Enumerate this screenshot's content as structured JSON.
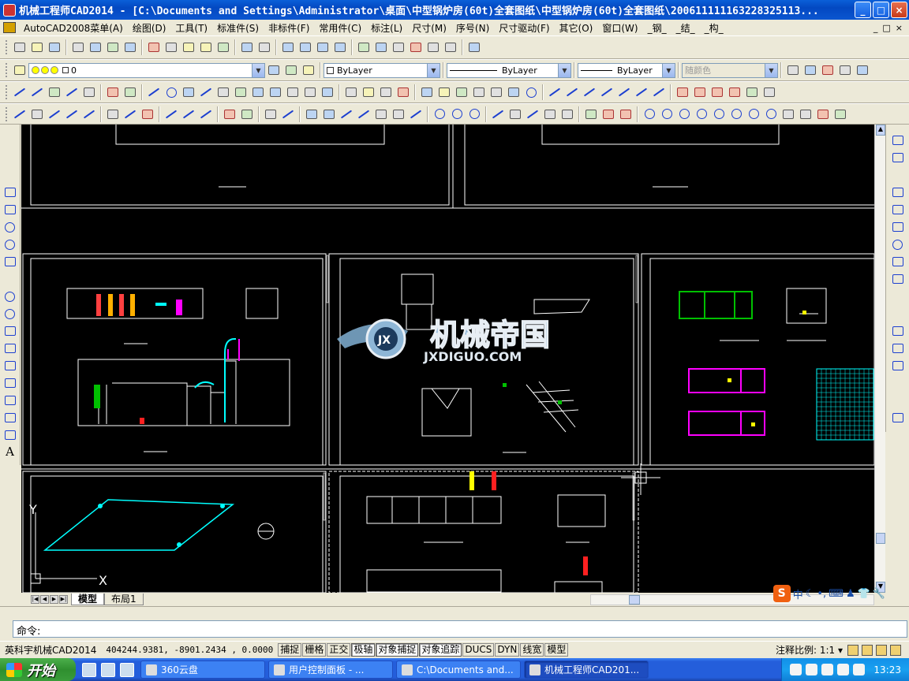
{
  "window": {
    "title": "机械工程师CAD2014 - [C:\\Documents and Settings\\Administrator\\桌面\\中型锅炉房(60t)全套图纸\\中型锅炉房(60t)全套图纸\\200611111163228325113...",
    "minimize": "_",
    "maximize": "□",
    "close": "×"
  },
  "menu": {
    "items": [
      "AutoCAD2008菜单(A)",
      "绘图(D)",
      "工具(T)",
      "标准件(S)",
      "非标件(F)",
      "常用件(C)",
      "标注(L)",
      "尺寸(M)",
      "序号(N)",
      "尺寸驱动(F)",
      "其它(O)",
      "窗口(W)",
      "_钢_",
      "_结_",
      "_构_"
    ],
    "doc_controls": [
      "_",
      "□",
      "×"
    ]
  },
  "layer_toolbar": {
    "layer_name": "0",
    "color": "ByLayer",
    "linetype": "ByLayer",
    "lineweight": "ByLayer",
    "plotstyle": "随颜色"
  },
  "drawing": {
    "watermark_cn": "机械帝国",
    "watermark_en": "JXDIGUO.COM",
    "watermark_badge": "JX",
    "axis_x": "X",
    "axis_y": "Y"
  },
  "tabs": {
    "items": [
      "模型",
      "布局1"
    ],
    "active": 0
  },
  "ime": {
    "logo": "S",
    "mode": "中"
  },
  "command": {
    "prompt": "命令:"
  },
  "status": {
    "app": "英科宇机械CAD2014",
    "coords": "404244.9381, -8901.2434 , 0.0000",
    "toggles": [
      {
        "label": "捕捉",
        "on": false
      },
      {
        "label": "栅格",
        "on": false
      },
      {
        "label": "正交",
        "on": false
      },
      {
        "label": "极轴",
        "on": true
      },
      {
        "label": "对象捕捉",
        "on": true
      },
      {
        "label": "对象追踪",
        "on": true
      },
      {
        "label": "DUCS",
        "on": false
      },
      {
        "label": "DYN",
        "on": false
      },
      {
        "label": "线宽",
        "on": false
      },
      {
        "label": "模型",
        "on": false
      }
    ],
    "annotation_scale": "注释比例: 1:1 ▾"
  },
  "taskbar": {
    "start": "开始",
    "tasks": [
      {
        "label": "360云盘",
        "active": false
      },
      {
        "label": "用户控制面板 - ...",
        "active": false
      },
      {
        "label": "C:\\Documents and...",
        "active": false
      },
      {
        "label": "机械工程师CAD201...",
        "active": true
      }
    ],
    "clock": "13:23"
  },
  "colors": {
    "titlebar": "#0348c1",
    "canvas": "#000000",
    "cad_line": "#ffffff",
    "cad_green": "#00c000",
    "cad_magenta": "#ff00ff",
    "cad_cyan": "#00ffff",
    "cad_yellow": "#ffff00",
    "cad_red": "#ff2020"
  }
}
